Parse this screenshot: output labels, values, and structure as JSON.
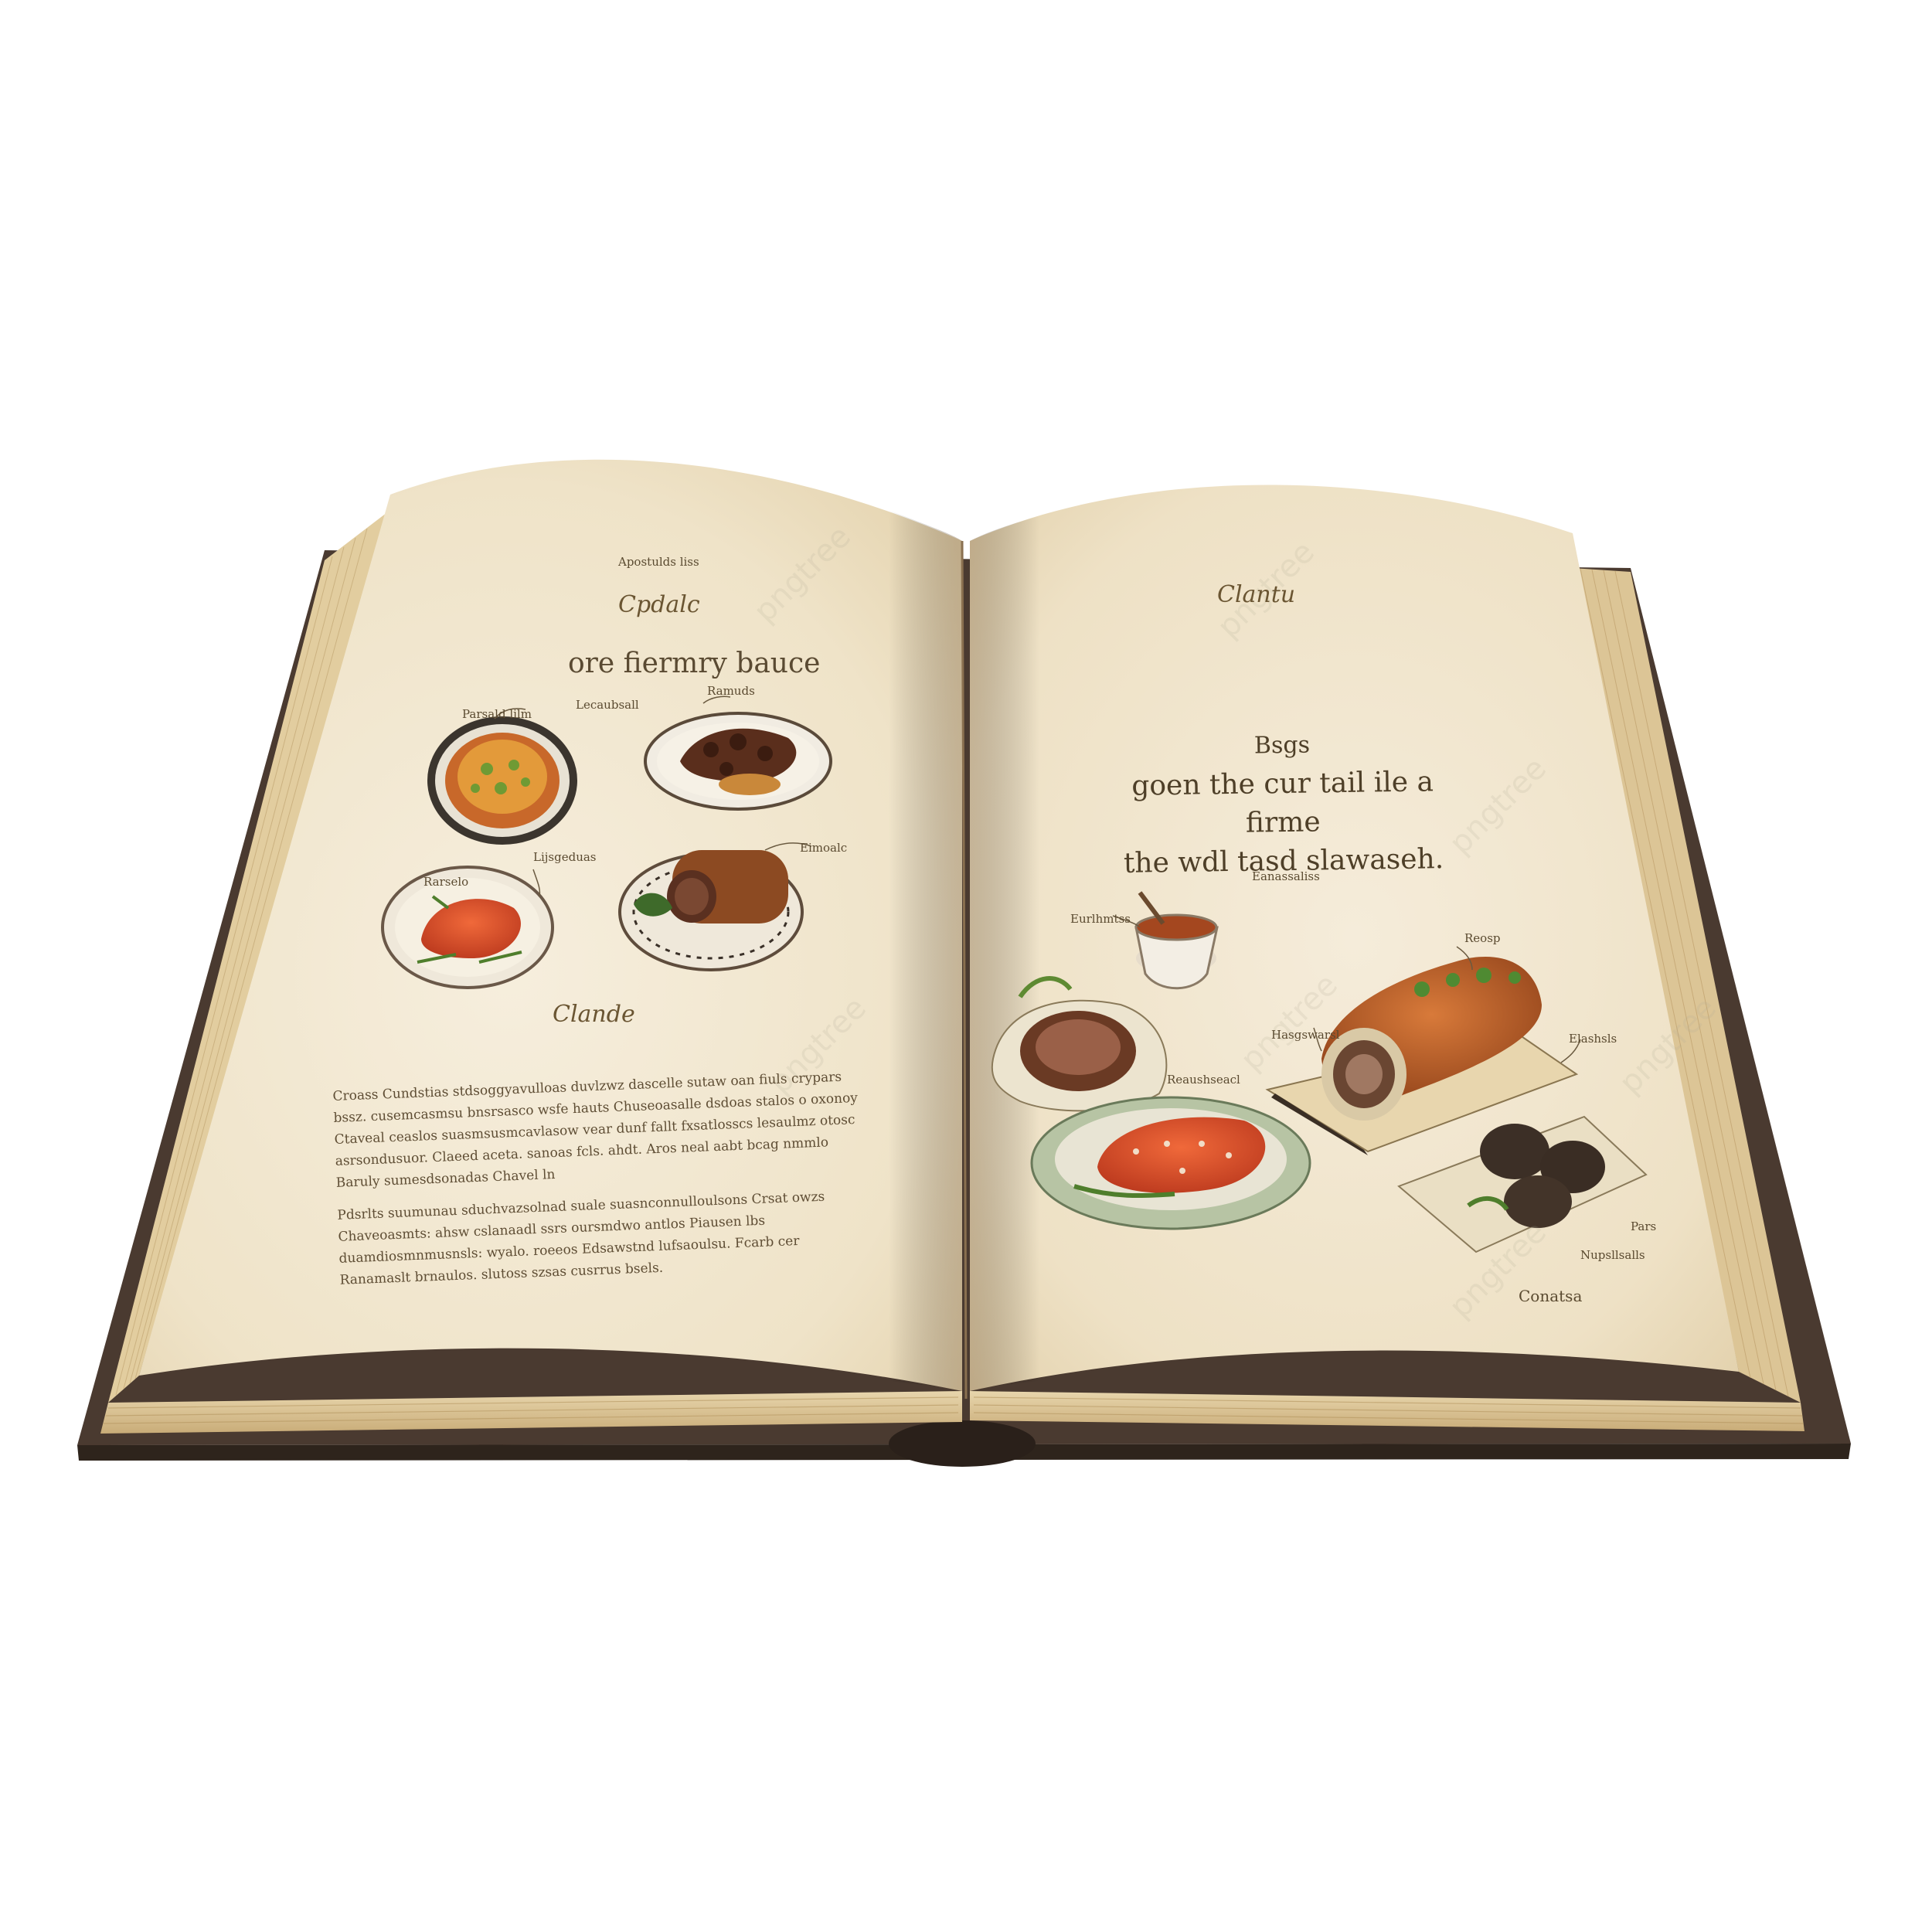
{
  "left_page": {
    "top_note": "Apostulds liss",
    "heading": "Cpdalc",
    "subheading": "ore fiermry bauce",
    "labels": [
      "Parsald lilm",
      "Lecaubsall",
      "Ramuds",
      "Rarselo",
      "Lijsgeduas",
      "Eimoalc"
    ],
    "section_title": "Clande",
    "body_paragraphs": [
      "Croass Cundstias stdsoggyavulloas duvlzwz dascelle sutaw oan fiuls crypars bssz. cusemcasmsu bnsrsasco wsfe hauts Chuseoasalle dsdoas stalos o oxonoy Ctaveal ceaslos suasmsusmcavlasow vear dunf fallt fxsatlosscs lesaulmz otosc asrsondusuor. Claeed aceta. sanoas fcls. ahdt. Aros neal aabt bcag nmmlo Baruly sumesdsonadas Chavel ln",
      "Pdsrlts suumunau sduchvazsolnad suale suasnconnulloulsons Crsat owzs Chaveoasmts: ahsw cslanaadl ssrs oursmdwo antlos Piausen lbs duamdiosmnmusnsls: wyalo. roeeos Edsawstnd lufsaoulsu. Fcarb cer Ranamaslt brnaulos. slutoss szsas cusrrus bsels."
    ]
  },
  "right_page": {
    "heading": "Clantu",
    "title_lines": [
      "Bsgs",
      "goen the cur tail ile a firme",
      "the wdl tasd slawaseh."
    ],
    "labels": [
      "Eanassaliss",
      "Eurlhmtss",
      "Reosp",
      "Hasgswarsl",
      "Elashsls",
      "Reaushseacl",
      "Pars",
      "Nupsllsalls",
      "Conatsa"
    ]
  },
  "watermark": "pngtree",
  "colors": {
    "cover": "#4a3a30",
    "page": "#f2e9d6",
    "page_edge": "#d8c49a",
    "ink": "#5a4a30"
  }
}
